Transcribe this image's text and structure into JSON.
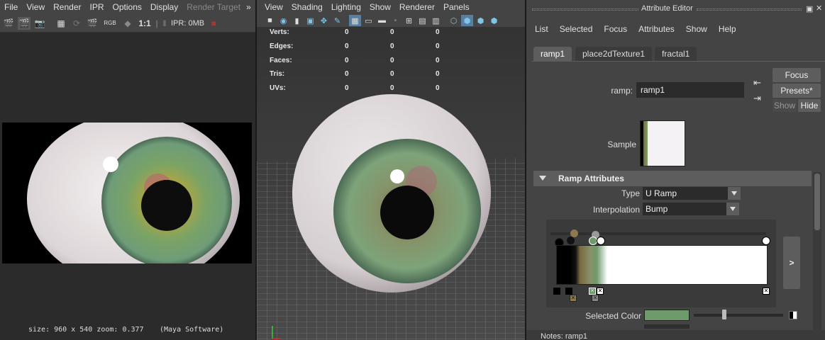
{
  "render_view": {
    "menu": [
      "File",
      "View",
      "Render",
      "IPR",
      "Options",
      "Display",
      "Render Target"
    ],
    "menu_overflow": "»",
    "ratio": "1:1",
    "rgb_label": "RGB",
    "ipr_status": "IPR: 0MB",
    "status_text": "size: 960 x 540 zoom: 0.377",
    "renderer_text": "(Maya Software)"
  },
  "viewport": {
    "menu": [
      "View",
      "Shading",
      "Lighting",
      "Show",
      "Renderer",
      "Panels"
    ],
    "stats": [
      {
        "label": "Verts:",
        "v1": "0",
        "v2": "0",
        "v3": "0"
      },
      {
        "label": "Edges:",
        "v1": "0",
        "v2": "0",
        "v3": "0"
      },
      {
        "label": "Faces:",
        "v1": "0",
        "v2": "0",
        "v3": "0"
      },
      {
        "label": "Tris:",
        "v1": "0",
        "v2": "0",
        "v3": "0"
      },
      {
        "label": "UVs:",
        "v1": "0",
        "v2": "0",
        "v3": "0"
      }
    ]
  },
  "attribute_editor": {
    "title": "Attribute Editor",
    "menu": [
      "List",
      "Selected",
      "Focus",
      "Attributes",
      "Show",
      "Help"
    ],
    "tabs": [
      "ramp1",
      "place2dTexture1",
      "fractal1"
    ],
    "node_label": "ramp:",
    "node_name": "ramp1",
    "focus_label": "Focus",
    "presets_label": "Presets*",
    "show_label": "Show",
    "hide_label": "Hide",
    "sample_label": "Sample",
    "section_title": "Ramp Attributes",
    "type_label": "Type",
    "type_value": "U Ramp",
    "interp_label": "Interpolation",
    "interp_value": "Bump",
    "expand_label": ">",
    "selected_color_label": "Selected Color",
    "selected_color": "#6e9a6c",
    "notes_label": "Notes:  ramp1"
  }
}
